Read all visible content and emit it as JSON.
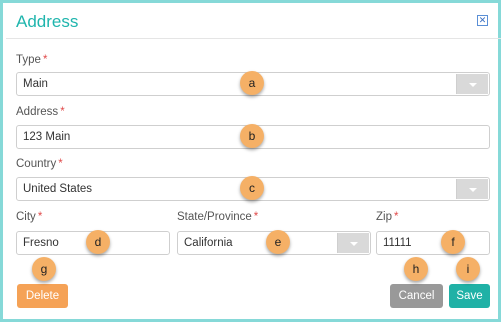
{
  "dialog": {
    "title": "Address",
    "close_icon": "close-icon"
  },
  "form": {
    "type": {
      "label": "Type",
      "required": "*",
      "value": "Main"
    },
    "address": {
      "label": "Address",
      "required": "*",
      "value": "123 Main"
    },
    "country": {
      "label": "Country",
      "required": "*",
      "value": "United States"
    },
    "city": {
      "label": "City",
      "required": "*",
      "value": "Fresno"
    },
    "state": {
      "label": "State/Province",
      "required": "*",
      "value": "California"
    },
    "zip": {
      "label": "Zip",
      "required": "*",
      "value": "11111"
    }
  },
  "buttons": {
    "delete": "Delete",
    "cancel": "Cancel",
    "save": "Save"
  },
  "callouts": {
    "a": "a",
    "b": "b",
    "c": "c",
    "d": "d",
    "e": "e",
    "f": "f",
    "g": "g",
    "h": "h",
    "i": "i"
  },
  "colors": {
    "accent": "#1fb5ad",
    "frame": "#86d9d8",
    "delete": "#f5a256",
    "cancel": "#999999",
    "save": "#20b1a6",
    "callout": "#f5b066",
    "required": "#e04a4a"
  }
}
